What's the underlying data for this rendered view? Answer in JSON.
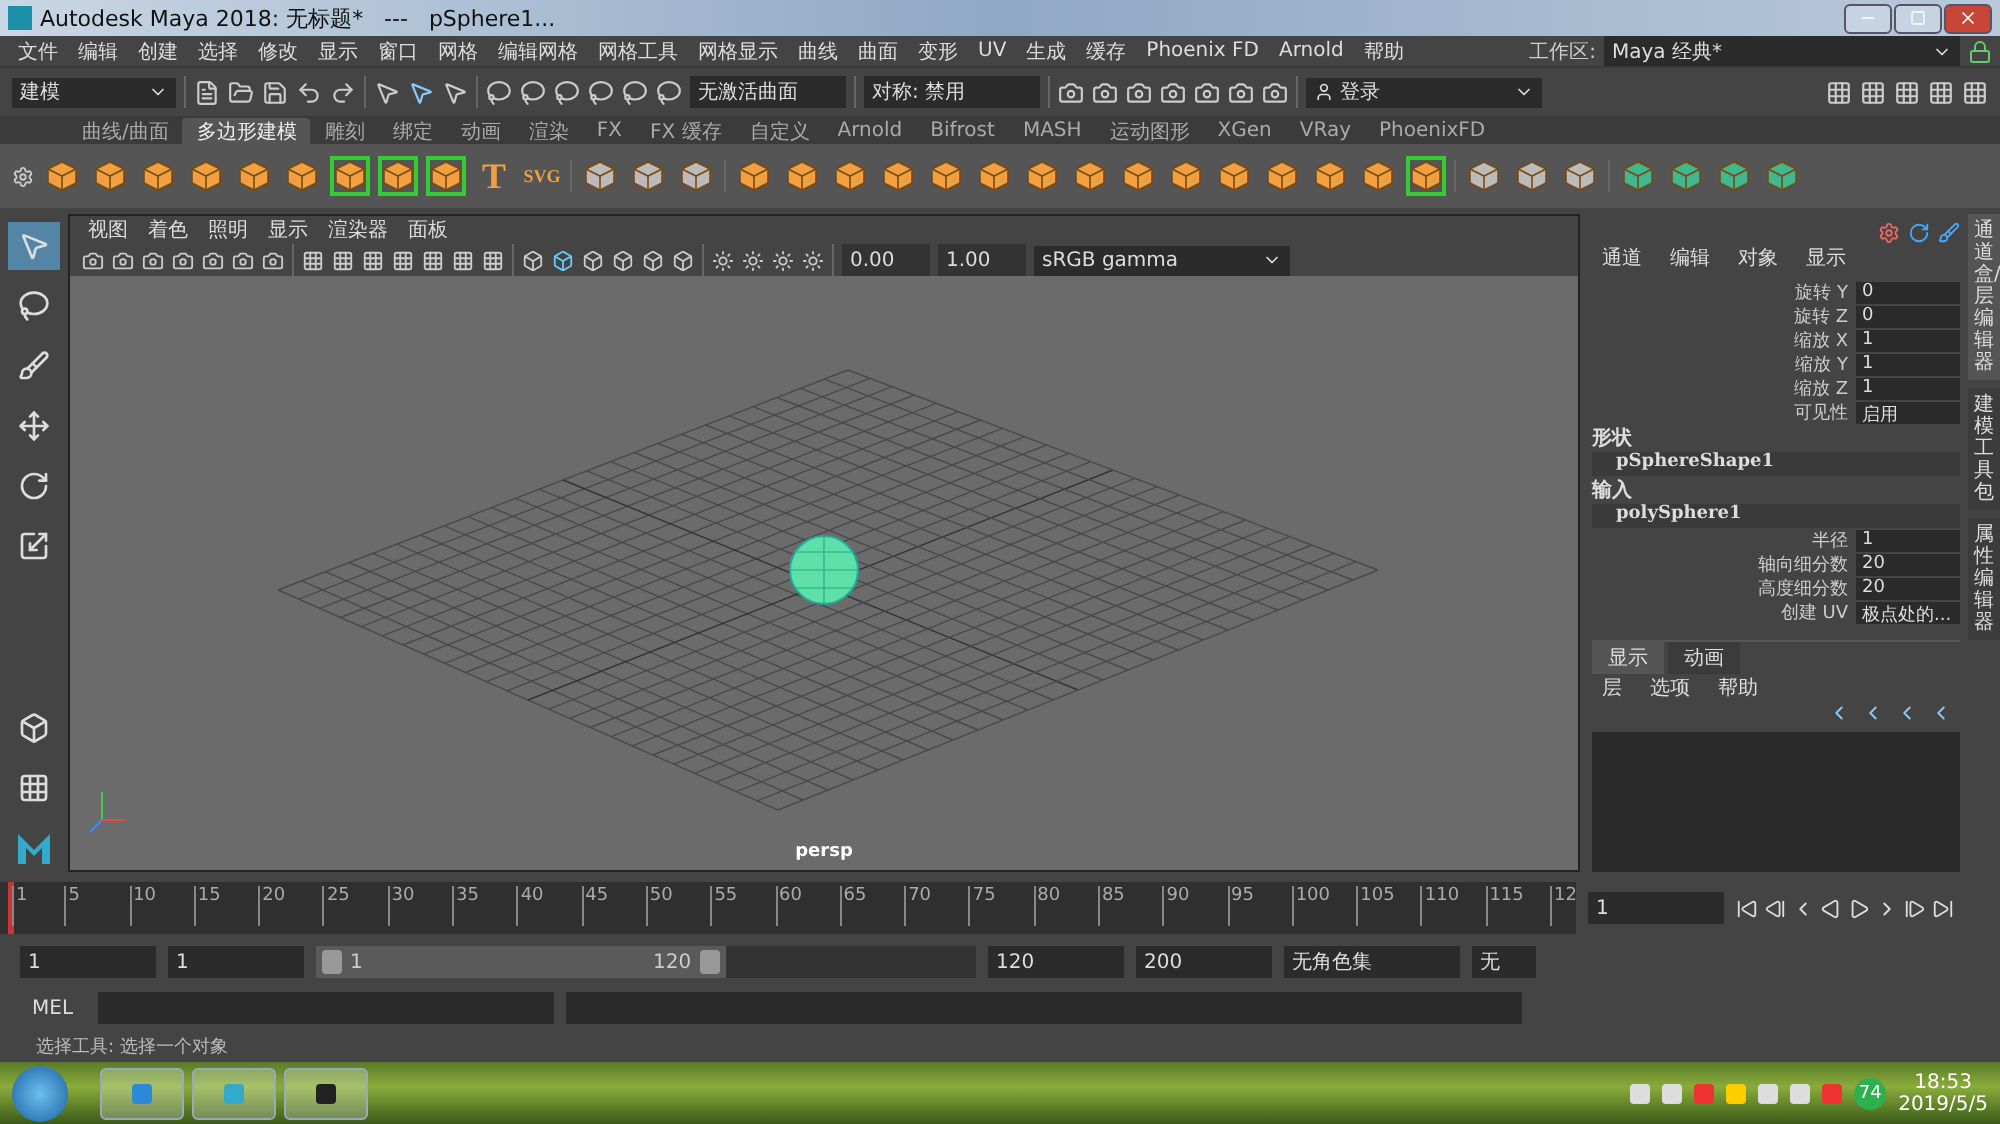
{
  "window": {
    "title": "Autodesk Maya 2018: 无标题*   ---   pSphere1..."
  },
  "menu": [
    "文件",
    "编辑",
    "创建",
    "选择",
    "修改",
    "显示",
    "窗口",
    "网格",
    "编辑网格",
    "网格工具",
    "网格显示",
    "曲线",
    "曲面",
    "变形",
    "UV",
    "生成",
    "缓存",
    "Phoenix FD",
    "Arnold",
    "帮助"
  ],
  "workspace": {
    "label": "工作区:",
    "value": "Maya 经典*"
  },
  "status_line": {
    "mode": "建模",
    "surface": "无激活曲面",
    "symmetry": "对称: 禁用",
    "login": "登录"
  },
  "shelf_tabs": [
    {
      "label": "曲线/曲面",
      "selected": false
    },
    {
      "label": "多边形建模",
      "selected": true
    },
    {
      "label": "雕刻",
      "selected": false
    },
    {
      "label": "绑定",
      "selected": false
    },
    {
      "label": "动画",
      "selected": false
    },
    {
      "label": "渲染",
      "selected": false
    },
    {
      "label": "FX",
      "selected": false
    },
    {
      "label": "FX 缓存",
      "selected": false
    },
    {
      "label": "自定义",
      "selected": false
    },
    {
      "label": "Arnold",
      "selected": false
    },
    {
      "label": "Bifrost",
      "selected": false
    },
    {
      "label": "MASH",
      "selected": false
    },
    {
      "label": "运动图形",
      "selected": false
    },
    {
      "label": "XGen",
      "selected": false
    },
    {
      "label": "VRay",
      "selected": false
    },
    {
      "label": "PhoenixFD",
      "selected": false
    }
  ],
  "shelf_items": [
    {
      "kind": "icon"
    },
    {
      "kind": "icon"
    },
    {
      "kind": "icon"
    },
    {
      "kind": "icon"
    },
    {
      "kind": "icon"
    },
    {
      "kind": "icon"
    },
    {
      "kind": "bracket"
    },
    {
      "kind": "bracket"
    },
    {
      "kind": "bracket"
    },
    {
      "kind": "glyph",
      "text": "T"
    },
    {
      "kind": "glyph",
      "text": "SVG"
    },
    {
      "kind": "sep"
    },
    {
      "kind": "gray"
    },
    {
      "kind": "gray"
    },
    {
      "kind": "gray"
    },
    {
      "kind": "sep"
    },
    {
      "kind": "icon"
    },
    {
      "kind": "icon"
    },
    {
      "kind": "icon"
    },
    {
      "kind": "icon"
    },
    {
      "kind": "icon"
    },
    {
      "kind": "icon"
    },
    {
      "kind": "icon"
    },
    {
      "kind": "icon"
    },
    {
      "kind": "icon"
    },
    {
      "kind": "icon"
    },
    {
      "kind": "icon"
    },
    {
      "kind": "icon"
    },
    {
      "kind": "icon"
    },
    {
      "kind": "icon"
    },
    {
      "kind": "bracket"
    },
    {
      "kind": "sep"
    },
    {
      "kind": "gray"
    },
    {
      "kind": "gray"
    },
    {
      "kind": "gray"
    },
    {
      "kind": "sep"
    },
    {
      "kind": "green"
    },
    {
      "kind": "green"
    },
    {
      "kind": "green"
    },
    {
      "kind": "green"
    }
  ],
  "viewport": {
    "menu": [
      "视图",
      "着色",
      "照明",
      "显示",
      "渲染器",
      "面板"
    ],
    "exposure": "0.00",
    "gamma": "1.00",
    "color_space": "sRGB gamma",
    "camera": "persp"
  },
  "channel_box": {
    "menu": [
      "通道",
      "编辑",
      "对象",
      "显示"
    ],
    "channels": [
      {
        "name": "旋转 Y",
        "value": "0"
      },
      {
        "name": "旋转 Z",
        "value": "0"
      },
      {
        "name": "缩放 X",
        "value": "1"
      },
      {
        "name": "缩放 Y",
        "value": "1"
      },
      {
        "name": "缩放 Z",
        "value": "1"
      },
      {
        "name": "可见性",
        "value": "启用"
      }
    ],
    "shape_heading": "形状",
    "shape": "pSphereShape1",
    "input_heading": "输入",
    "input": "polySphere1",
    "inputs": [
      {
        "name": "半径",
        "value": "1"
      },
      {
        "name": "轴向细分数",
        "value": "20"
      },
      {
        "name": "高度细分数",
        "value": "20"
      },
      {
        "name": "创建 UV",
        "value": "极点处的..."
      }
    ]
  },
  "layer_editor": {
    "tabs": [
      {
        "label": "显示",
        "selected": true
      },
      {
        "label": "动画",
        "selected": false
      }
    ],
    "menu": [
      "层",
      "选项",
      "帮助"
    ]
  },
  "side_tabs": [
    {
      "label": "通道盒/层编辑器",
      "selected": true
    },
    {
      "label": "建模工具包",
      "selected": false
    },
    {
      "label": "属性编辑器",
      "selected": false
    }
  ],
  "timeline": {
    "labels": [
      "1",
      "5",
      "10",
      "15",
      "20",
      "25",
      "30",
      "35",
      "40",
      "45",
      "50",
      "55",
      "60",
      "65",
      "70",
      "75",
      "80",
      "85",
      "90",
      "95",
      "100",
      "105",
      "110",
      "115",
      "12"
    ],
    "current_frame": "1",
    "level": 0.005
  },
  "range": {
    "start": "1",
    "playback_start": "1",
    "slider_start": "1",
    "slider_end": "120",
    "level": 0.62,
    "playback_end": "120",
    "end": "200",
    "character_set": "无角色集",
    "anim_layer": "无"
  },
  "command_line": {
    "language": "MEL"
  },
  "help_line": "选择工具: 选择一个对象",
  "taskbar": {
    "badge": "74",
    "time": "18:53",
    "date": "2019/5/5"
  }
}
